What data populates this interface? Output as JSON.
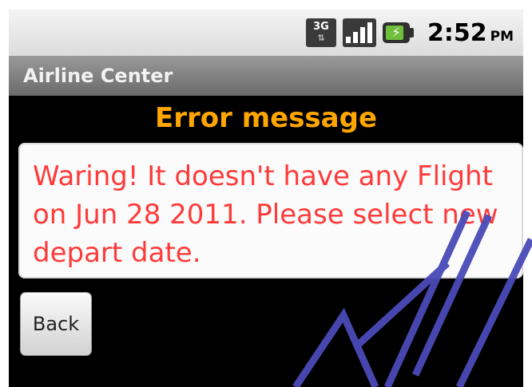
{
  "status_bar": {
    "network_label": "3G",
    "network_arrows": "⇅",
    "signal_bars": 4,
    "battery_bolt": "⚡",
    "time": "2:52",
    "ampm": "PM"
  },
  "app": {
    "title": "Airline Center"
  },
  "content": {
    "heading": "Error message",
    "message": "Waring! It doesn't have any Flight on Jun 28 2011. Please select new depart date.",
    "back_label": "Back"
  },
  "colors": {
    "heading": "#ffa600",
    "message_text": "#ff3a3a",
    "background": "#000000",
    "title_bar": "#7a7a7a",
    "watermark": "#4a4ab8"
  },
  "icons": {
    "network": "network-3g-icon",
    "signal": "signal-strength-icon",
    "battery": "battery-charging-icon"
  }
}
